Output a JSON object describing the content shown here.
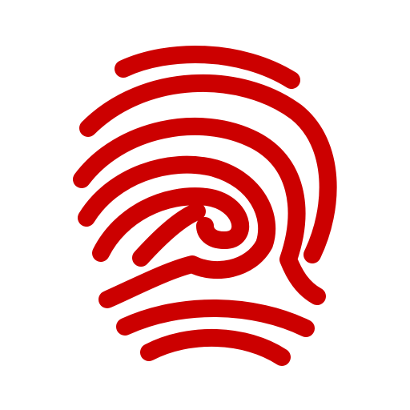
{
  "icon": {
    "name": "fingerprint-icon",
    "color": "#cc0000",
    "background": "#ffffff"
  }
}
